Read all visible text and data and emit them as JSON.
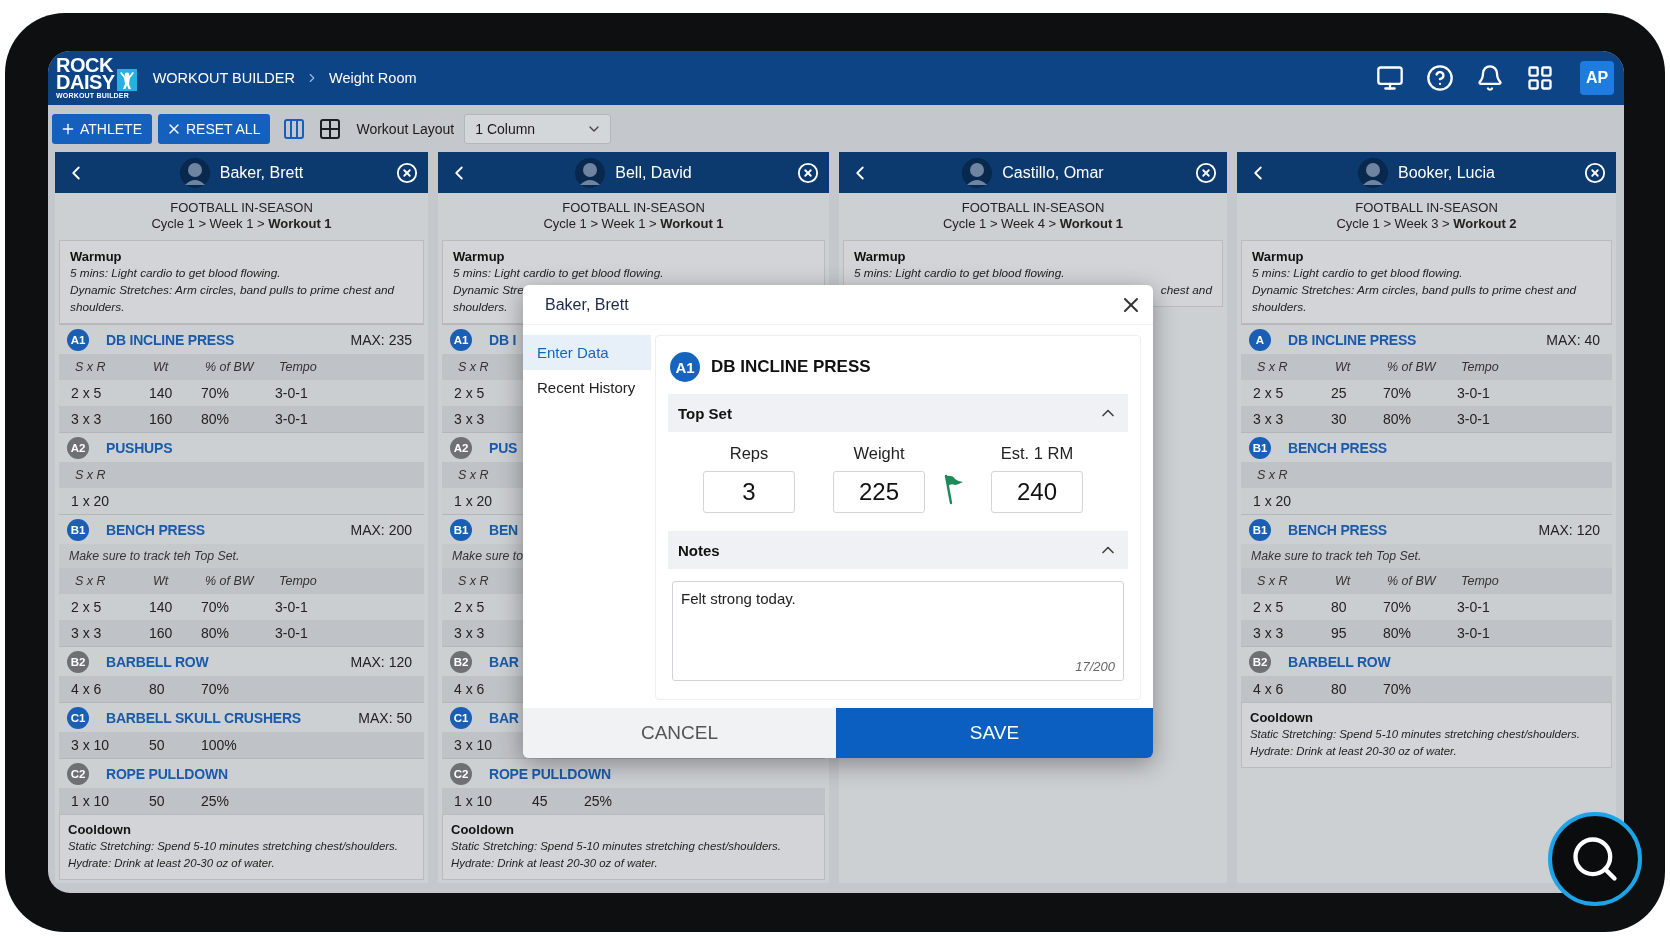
{
  "app": {
    "logo": {
      "line1": "ROCK",
      "line2": "DAISY",
      "tagline": "WORKOUT BUILDER"
    },
    "breadcrumb": [
      "WORKOUT BUILDER",
      "Weight Room"
    ],
    "avatar": "AP"
  },
  "toolbar": {
    "buttons": [
      {
        "label": "ATHLETE",
        "kind": "add"
      },
      {
        "label": "RESET ALL",
        "kind": "reset"
      }
    ],
    "layout_toggles": [
      {
        "kind": "columns",
        "selected": true
      },
      {
        "kind": "grid",
        "selected": false
      }
    ],
    "layout_label": "Workout Layout",
    "layout_select": "1 Column"
  },
  "athletes": [
    {
      "name": "Baker, Brett",
      "program": "FOOTBALL IN-SEASON",
      "cycle": "Cycle 1 > Week 1 > **Workout 1**",
      "warmup": {
        "title": "Warmup",
        "lines": [
          "5 mins: Light cardio to get blood flowing.",
          "Dynamic Stretches: Arm circles, band pulls to prime chest and shoulders."
        ]
      },
      "exercises": [
        {
          "badge": "A1",
          "color": "#1a5fb4",
          "name": "DB INCLINE PRESS",
          "max": "MAX: 235",
          "columns": [
            "S x R",
            "Wt",
            "% of BW",
            "Tempo"
          ],
          "rows": [
            [
              "2 x 5",
              "140",
              "70%",
              "3-0-1"
            ],
            [
              "3 x 3",
              "160",
              "80%",
              "3-0-1"
            ]
          ]
        },
        {
          "badge": "A2",
          "color": "#6d7074",
          "name": "PUSHUPS",
          "columns": [
            "S x R"
          ],
          "rows": [
            [
              "1 x 20"
            ]
          ]
        },
        {
          "badge": "B1",
          "color": "#1a5fb4",
          "name": "BENCH PRESS",
          "max": "MAX: 200",
          "note": "Make sure to track teh Top Set.",
          "columns": [
            "S x R",
            "Wt",
            "% of BW",
            "Tempo"
          ],
          "rows": [
            [
              "2 x 5",
              "140",
              "70%",
              "3-0-1"
            ],
            [
              "3 x 3",
              "160",
              "80%",
              "3-0-1"
            ]
          ]
        },
        {
          "badge": "B2",
          "color": "#6d7074",
          "name": "BARBELL ROW",
          "max": "MAX: 120",
          "rows": [
            [
              "4 x 6",
              "80",
              "70%"
            ]
          ]
        },
        {
          "badge": "C1",
          "color": "#1a5fb4",
          "name": "BARBELL SKULL CRUSHERS",
          "max": "MAX: 50",
          "rows": [
            [
              "3 x 10",
              "50",
              "100%"
            ]
          ]
        },
        {
          "badge": "C2",
          "color": "#6d7074",
          "name": "ROPE PULLDOWN",
          "rows": [
            [
              "1 x 10",
              "50",
              "25%"
            ]
          ]
        }
      ],
      "cooldown": {
        "title": "Cooldown",
        "lines": [
          "Static Stretching: Spend 5-10 minutes stretching chest/shoulders.",
          "Hydrate: Drink at least 20-30 oz of water."
        ]
      }
    },
    {
      "name": "Bell, David",
      "program": "FOOTBALL IN-SEASON",
      "cycle": "Cycle 1 > Week 1 > **Workout 1**",
      "warmup": {
        "title": "Warmup",
        "lines": [
          "5 mins: Light cardio to get blood flowing.",
          "Dynamic Stre",
          "shoulders."
        ]
      },
      "exercises": [
        {
          "badge": "A1",
          "color": "#1a5fb4",
          "name": "DB I",
          "columns": [
            "S x R"
          ],
          "rows": [
            [
              "2 x 5"
            ],
            [
              "3 x 3"
            ]
          ]
        },
        {
          "badge": "A2",
          "color": "#6d7074",
          "name": "PUS",
          "columns": [
            "S x R"
          ],
          "rows": [
            [
              "1 x 20"
            ]
          ]
        },
        {
          "badge": "B1",
          "color": "#1a5fb4",
          "name": "BEN",
          "note": "Make sure to",
          "columns": [
            "S x R"
          ],
          "rows": [
            [
              "2 x 5"
            ],
            [
              "3 x 3"
            ]
          ]
        },
        {
          "badge": "B2",
          "color": "#6d7074",
          "name": "BAR",
          "rows": [
            [
              "4 x 6"
            ]
          ]
        },
        {
          "badge": "C1",
          "color": "#1a5fb4",
          "name": "BAR",
          "rows": [
            [
              "3 x 10"
            ]
          ]
        },
        {
          "badge": "C2",
          "color": "#6d7074",
          "name": "ROPE PULLDOWN",
          "rows": [
            [
              "1 x 10",
              "45",
              "25%"
            ]
          ]
        }
      ],
      "cooldown": {
        "title": "Cooldown",
        "lines": [
          "Static Stretching: Spend 5-10 minutes stretching chest/shoulders.",
          "Hydrate: Drink at least 20-30 oz of water."
        ]
      }
    },
    {
      "name": "Castillo, Omar",
      "program": "FOOTBALL IN-SEASON",
      "cycle": "Cycle 1 > Week 4 > **Workout 1**",
      "warmup": {
        "title": "Warmup",
        "lines": [
          "5 mins: Light cardio to get blood flowing."
        ],
        "trailing_fragment": "chest and"
      }
    },
    {
      "name": "Booker, Lucia",
      "program": "FOOTBALL IN-SEASON",
      "cycle": "Cycle 1 > Week 3 > **Workout 2**",
      "warmup": {
        "title": "Warmup",
        "lines": [
          "5 mins: Light cardio to get blood flowing.",
          "Dynamic Stretches: Arm circles, band pulls to prime chest and shoulders."
        ]
      },
      "exercises": [
        {
          "badge": "A",
          "color": "#1a5fb4",
          "name": "DB INCLINE PRESS",
          "max": "MAX: 40",
          "columns": [
            "S x R",
            "Wt",
            "% of BW",
            "Tempo"
          ],
          "rows": [
            [
              "2 x 5",
              "25",
              "70%",
              "3-0-1"
            ],
            [
              "3 x 3",
              "30",
              "80%",
              "3-0-1"
            ]
          ]
        },
        {
          "badge": "B1",
          "color": "#1a5fb4",
          "name": "BENCH PRESS",
          "columns": [
            "S x R"
          ],
          "rows": [
            [
              "1 x 20"
            ]
          ]
        },
        {
          "badge": "B1",
          "color": "#1a5fb4",
          "name": "BENCH PRESS",
          "max": "MAX: 120",
          "note": "Make sure to track teh Top Set.",
          "columns": [
            "S x R",
            "Wt",
            "% of BW",
            "Tempo"
          ],
          "rows": [
            [
              "2 x 5",
              "80",
              "70%",
              "3-0-1"
            ],
            [
              "3 x 3",
              "95",
              "80%",
              "3-0-1"
            ]
          ]
        },
        {
          "badge": "B2",
          "color": "#6d7074",
          "name": "BARBELL ROW",
          "rows": [
            [
              "4 x 6",
              "80",
              "70%"
            ]
          ]
        }
      ],
      "cooldown": {
        "title": "Cooldown",
        "lines": [
          "Static Stretching: Spend 5-10 minutes stretching chest/shoulders.",
          "Hydrate: Drink at least 20-30 oz of water."
        ]
      }
    }
  ],
  "modal": {
    "title": "Baker, Brett",
    "nav": [
      {
        "label": "Enter Data",
        "selected": true
      },
      {
        "label": "Recent History",
        "selected": false
      }
    ],
    "exercise": {
      "badge": "A1",
      "color": "#1565c0",
      "name": "DB INCLINE PRESS"
    },
    "top_set": {
      "title": "Top Set",
      "expanded": true,
      "fields": [
        {
          "label": "Reps",
          "value": "3",
          "flagged": false
        },
        {
          "label": "Weight",
          "value": "225",
          "flagged": true
        },
        {
          "label": "Est. 1 RM",
          "value": "240",
          "flagged": false
        }
      ]
    },
    "notes": {
      "title": "Notes",
      "expanded": true,
      "value": "Felt strong today.",
      "counter": "17/200"
    },
    "buttons": [
      {
        "label": "CANCEL",
        "kind": "cancel"
      },
      {
        "label": "SAVE",
        "kind": "save"
      }
    ]
  }
}
